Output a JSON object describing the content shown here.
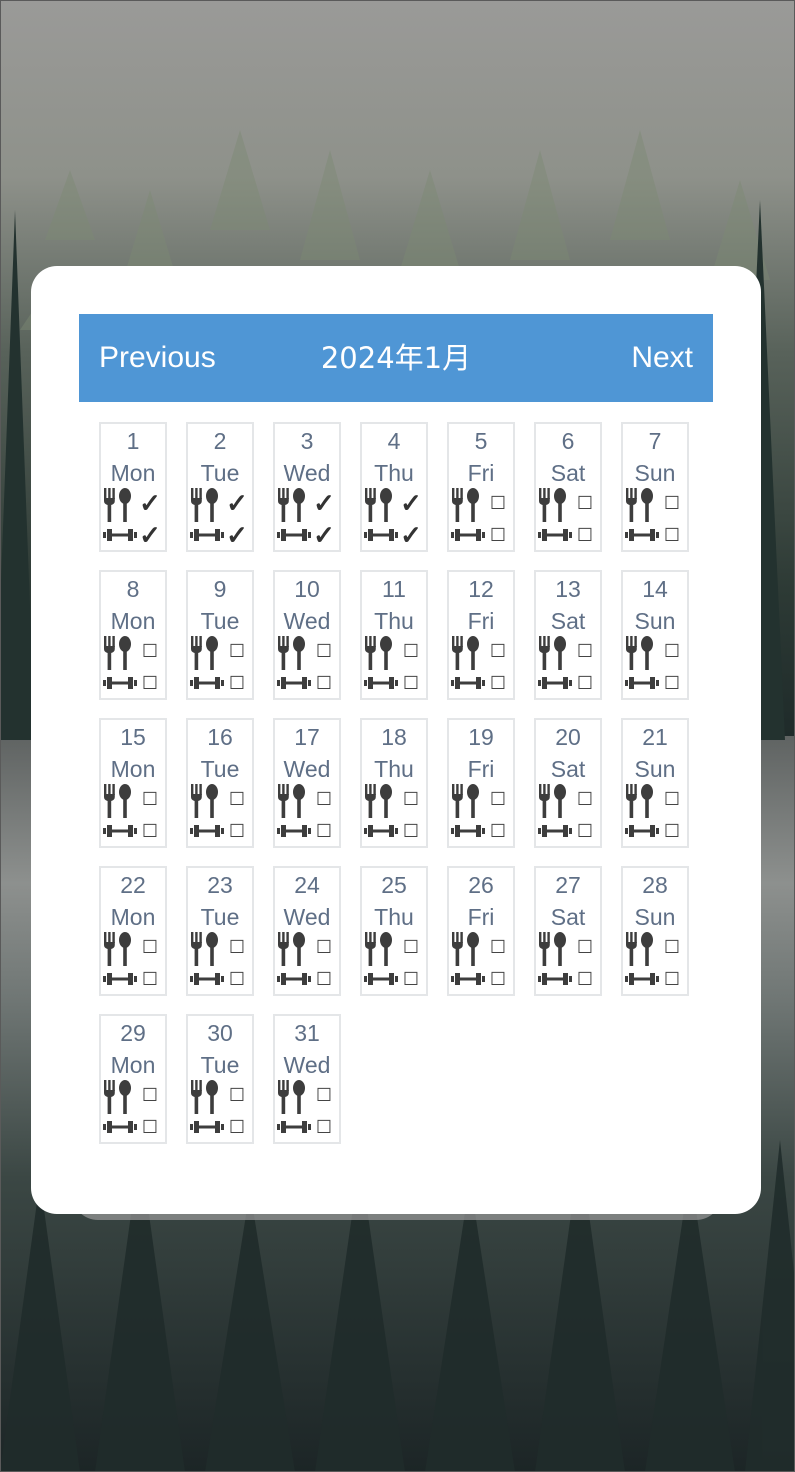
{
  "calendar": {
    "previous_label": "Previous",
    "next_label": "Next",
    "month_title": "2024年1月"
  },
  "checkmark_symbol": "✓",
  "empty_symbol": "☐",
  "days": [
    {
      "num": "1",
      "wd": "Mon",
      "meal": true,
      "gym": true
    },
    {
      "num": "2",
      "wd": "Tue",
      "meal": true,
      "gym": true
    },
    {
      "num": "3",
      "wd": "Wed",
      "meal": true,
      "gym": true
    },
    {
      "num": "4",
      "wd": "Thu",
      "meal": true,
      "gym": true
    },
    {
      "num": "5",
      "wd": "Fri",
      "meal": false,
      "gym": false
    },
    {
      "num": "6",
      "wd": "Sat",
      "meal": false,
      "gym": false
    },
    {
      "num": "7",
      "wd": "Sun",
      "meal": false,
      "gym": false
    },
    {
      "num": "8",
      "wd": "Mon",
      "meal": false,
      "gym": false
    },
    {
      "num": "9",
      "wd": "Tue",
      "meal": false,
      "gym": false
    },
    {
      "num": "10",
      "wd": "Wed",
      "meal": false,
      "gym": false
    },
    {
      "num": "11",
      "wd": "Thu",
      "meal": false,
      "gym": false
    },
    {
      "num": "12",
      "wd": "Fri",
      "meal": false,
      "gym": false
    },
    {
      "num": "13",
      "wd": "Sat",
      "meal": false,
      "gym": false
    },
    {
      "num": "14",
      "wd": "Sun",
      "meal": false,
      "gym": false
    },
    {
      "num": "15",
      "wd": "Mon",
      "meal": false,
      "gym": false
    },
    {
      "num": "16",
      "wd": "Tue",
      "meal": false,
      "gym": false
    },
    {
      "num": "17",
      "wd": "Wed",
      "meal": false,
      "gym": false
    },
    {
      "num": "18",
      "wd": "Thu",
      "meal": false,
      "gym": false
    },
    {
      "num": "19",
      "wd": "Fri",
      "meal": false,
      "gym": false
    },
    {
      "num": "20",
      "wd": "Sat",
      "meal": false,
      "gym": false
    },
    {
      "num": "21",
      "wd": "Sun",
      "meal": false,
      "gym": false
    },
    {
      "num": "22",
      "wd": "Mon",
      "meal": false,
      "gym": false
    },
    {
      "num": "23",
      "wd": "Tue",
      "meal": false,
      "gym": false
    },
    {
      "num": "24",
      "wd": "Wed",
      "meal": false,
      "gym": false
    },
    {
      "num": "25",
      "wd": "Thu",
      "meal": false,
      "gym": false
    },
    {
      "num": "26",
      "wd": "Fri",
      "meal": false,
      "gym": false
    },
    {
      "num": "27",
      "wd": "Sat",
      "meal": false,
      "gym": false
    },
    {
      "num": "28",
      "wd": "Sun",
      "meal": false,
      "gym": false
    },
    {
      "num": "29",
      "wd": "Mon",
      "meal": false,
      "gym": false
    },
    {
      "num": "30",
      "wd": "Tue",
      "meal": false,
      "gym": false
    },
    {
      "num": "31",
      "wd": "Wed",
      "meal": false,
      "gym": false
    }
  ],
  "icons": {
    "meal": "fork-spoon-icon",
    "gym": "dumbbell-icon"
  },
  "colors": {
    "header": "#4f96d5",
    "day_text": "#5f6f86",
    "cell_border": "#e4e6e8"
  }
}
